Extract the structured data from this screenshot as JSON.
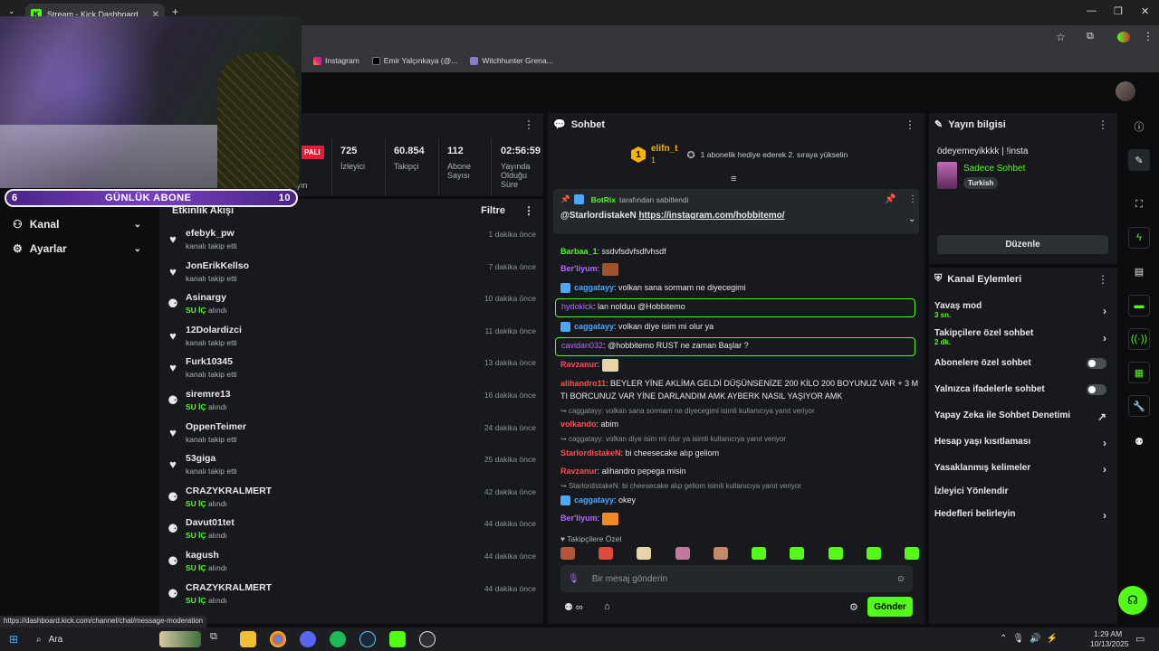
{
  "browser": {
    "tab_title": "Stream - Kick Dashboard",
    "bookmarks": [
      "Instagram",
      "Emir Yalçınkaya (@...",
      "Witchhunter Grena..."
    ],
    "status_url": "https://dashboard.kick.com/channel/chat/message-moderation"
  },
  "overlay": {
    "sub_left": "6",
    "sub_label": "GÜNLÜK ABONE",
    "sub_right": "10"
  },
  "sidebar": {
    "items": [
      {
        "label": "Kanal"
      },
      {
        "label": "Ayarlar"
      }
    ]
  },
  "stats": {
    "live_badge": "PALI",
    "partial_label": "ku yayın",
    "items": [
      {
        "value": "725",
        "label": "İzleyici"
      },
      {
        "value": "60.854",
        "label": "Takipçi"
      },
      {
        "value": "112",
        "label": "Abone Sayısı"
      },
      {
        "value": "02:56:59",
        "label": "Yayında Olduğu Süre"
      }
    ]
  },
  "feed": {
    "title": "Etkinlik Akışı",
    "filter_label": "Filtre",
    "items": [
      {
        "name": "efebyk_pw",
        "action": "kanalı takip etti",
        "time": "1 dakika önce",
        "type": "follow"
      },
      {
        "name": "JonErikKellso",
        "action": "kanalı takip etti",
        "time": "7 dakika önce",
        "type": "follow"
      },
      {
        "name": "Asinargy",
        "highlight": "SU İÇ",
        "action": "alındı",
        "time": "10 dakika önce",
        "type": "reward"
      },
      {
        "name": "12Dolardizci",
        "action": "kanalı takip etti",
        "time": "11 dakika önce",
        "type": "follow"
      },
      {
        "name": "Furk10345",
        "action": "kanalı takip etti",
        "time": "13 dakika önce",
        "type": "follow"
      },
      {
        "name": "siremre13",
        "highlight": "SU İÇ",
        "action": "alındı",
        "time": "16 dakika önce",
        "type": "reward"
      },
      {
        "name": "OppenTeimer",
        "action": "kanalı takip etti",
        "time": "24 dakika önce",
        "type": "follow"
      },
      {
        "name": "53giga",
        "action": "kanalı takip etti",
        "time": "25 dakika önce",
        "type": "follow"
      },
      {
        "name": "CRAZYKRALMERT",
        "highlight": "SU İÇ",
        "action": "alındı",
        "time": "42 dakika önce",
        "type": "reward"
      },
      {
        "name": "Davut01tet",
        "highlight": "SU İÇ",
        "action": "alındı",
        "time": "44 dakika önce",
        "type": "reward"
      },
      {
        "name": "kagush",
        "highlight": "SU İÇ",
        "action": "alındı",
        "time": "44 dakika önce",
        "type": "reward"
      },
      {
        "name": "CRAZYKRALMERT",
        "highlight": "SU İÇ",
        "action": "alındı",
        "time": "44 dakika önce",
        "type": "reward"
      }
    ]
  },
  "chat": {
    "title": "Sohbet",
    "leader_name": "elifn_t",
    "leader_count": "1",
    "gift_text": "1 abonelik hediye ederek 2. sıraya yükselin",
    "pinned_by": "BotRix",
    "pinned_suffix": "tarafından sabitlendi",
    "pinned_user": "@StarlordistakeN",
    "pinned_link": "https://instagram.com/hobbitemo/",
    "messages": [
      {
        "user": "Barbaa_1",
        "text": "ssdvfsdvfsdfvhsdf",
        "color": "#53fc18"
      },
      {
        "user": "Ber'liyum",
        "text": "",
        "color": "#b36bff",
        "emote": true
      },
      {
        "user": "caggatayy",
        "text": "volkan sana sormam ne diyecegimi",
        "color": "#4aa8ff"
      },
      {
        "user": "hydokick",
        "text": "lan nolduu @Hobbitemo",
        "color": "#b36bff",
        "boxed": true
      },
      {
        "user": "caggatayy",
        "text": "volkan diye isim mi olur ya",
        "color": "#4aa8ff"
      },
      {
        "user": "cavidan032",
        "text": "@hobbitemo RUST ne zaman Başlar ?",
        "color": "#b36bff",
        "boxed": true
      },
      {
        "user": "Ravzanur",
        "text": "",
        "color": "#ff4d5a",
        "emote": true
      },
      {
        "user": "alihandro11",
        "text": "BEYLER YİNE AKLİMA GELDİ DÜŞÜNSENİZE 200 KİLO 200 BOYUNUZ VAR + 3 M TI BORCUNUZ VAR YİNE DARLANDIM AMK AYBERK NASIL YAŞIYOR AMK",
        "color": "#ff4d5a"
      },
      {
        "reply": "caggatayy: volkan sana sormam ne diyecegimi isimli kullanıcıya yanıt veriyor"
      },
      {
        "user": "volkando",
        "text": "abim",
        "color": "#ff4d5a"
      },
      {
        "reply": "caggatayy: volkan diye isim mi olur ya isimli kullanıcıya yanıt veriyor"
      },
      {
        "user": "StarlordistakeN",
        "text": "bi cheesecake alıp geliom",
        "color": "#ff4d5a"
      },
      {
        "user": "Ravzanur",
        "text": "alihandro pepega misin",
        "color": "#ff4d5a"
      },
      {
        "reply": "StarlordistakeN: bi cheesecake alıp geliom isimli kullanıcıya yanıt veriyor"
      },
      {
        "user": "caggatayy",
        "text": "okey",
        "color": "#4aa8ff"
      },
      {
        "user": "Ber'liyum",
        "text": "",
        "color": "#b36bff",
        "emote": true
      }
    ],
    "followers_only_label": "Takipçilere Özel",
    "input_placeholder": "Bir mesaj gönderin",
    "send_label": "Gönder"
  },
  "stream_info": {
    "title": "Yayın bilgisi",
    "stream_title": "ödeyemeyikkkk | !insta",
    "category": "Sadece Sohbet",
    "language": "Turkish",
    "edit_label": "Düzenle"
  },
  "channel_actions": {
    "title": "Kanal Eylemleri",
    "items": [
      {
        "label": "Yavaş mod",
        "sub": "3 sn.",
        "kind": "arrow"
      },
      {
        "label": "Takipçilere özel sohbet",
        "sub": "2 dk.",
        "kind": "arrow"
      },
      {
        "label": "Abonelere özel sohbet",
        "kind": "toggle"
      },
      {
        "label": "Yalnızca ifadelerle sohbet",
        "kind": "toggle"
      },
      {
        "label": "Yapay Zeka ile Sohbet Denetimi",
        "kind": "external"
      },
      {
        "label": "Hesap yaşı kısıtlaması",
        "kind": "arrow"
      },
      {
        "label": "Yasaklanmış kelimeler",
        "kind": "arrow"
      },
      {
        "label": "İzleyici Yönlendir",
        "kind": "none"
      },
      {
        "label": "Hedefleri belirleyin",
        "kind": "arrow"
      }
    ]
  },
  "taskbar": {
    "search_label": "Ara",
    "time": "1:29 AM",
    "date": "10/13/2025"
  },
  "colors": {
    "accent": "#53fc18",
    "panel": "#17191c",
    "bg": "#0b0d0f"
  }
}
